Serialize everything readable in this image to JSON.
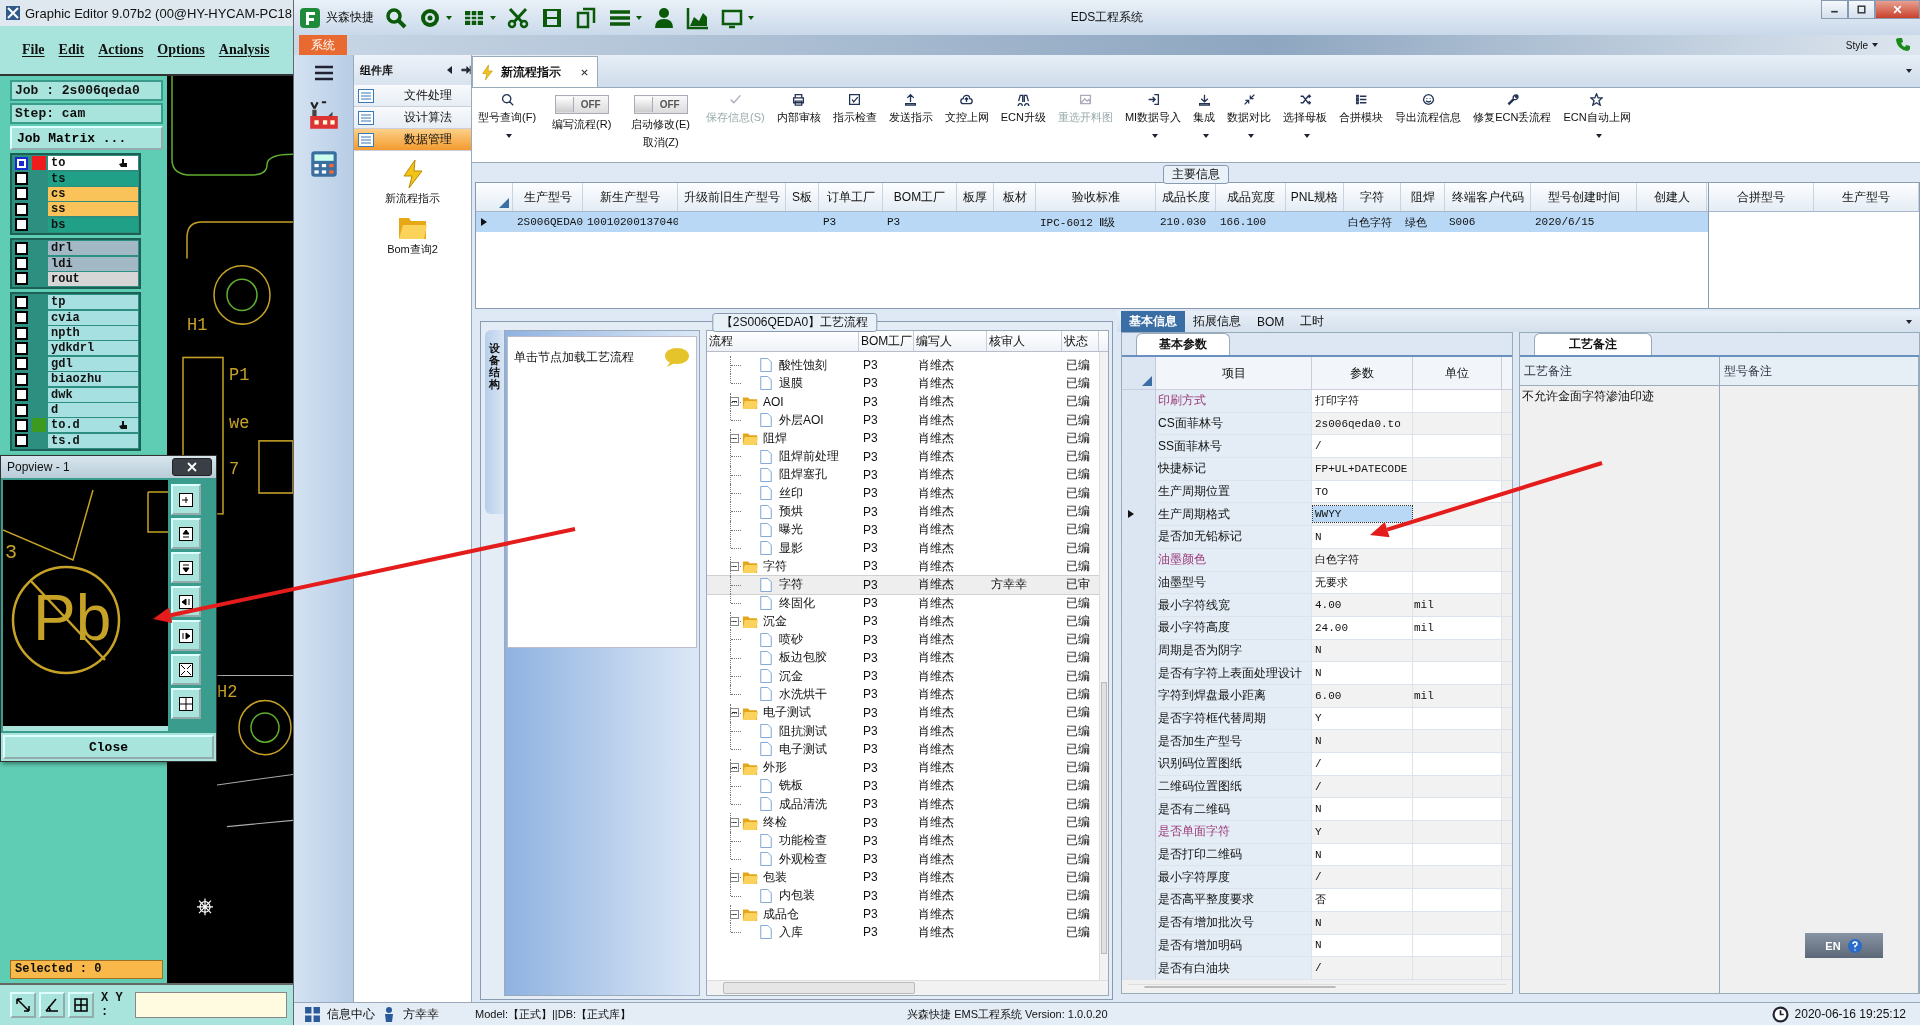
{
  "graphic_editor": {
    "title": "Graphic Editor 9.07b2 (00@HY-HYCAM-PC18",
    "menu": [
      "File",
      "Edit",
      "Actions",
      "Options",
      "Analysis"
    ],
    "job": "Job : 2s006qeda0",
    "step": "Step: cam",
    "matrix_button": "Job Matrix ...",
    "layer_groups": [
      [
        {
          "name": "to",
          "color": "#ffffff",
          "selected": true,
          "work_layer": true,
          "affected": false,
          "marked": true
        },
        {
          "name": "ts",
          "color": "#1fa087",
          "selected": false,
          "work_layer": false,
          "affected": false,
          "marked": false
        },
        {
          "name": "cs",
          "color": "#f9c35a",
          "selected": false,
          "work_layer": false,
          "affected": false,
          "marked": false
        },
        {
          "name": "ss",
          "color": "#f9c35a",
          "selected": false,
          "work_layer": false,
          "affected": false,
          "marked": false
        },
        {
          "name": "bs",
          "color": "#1fa087",
          "selected": false,
          "work_layer": false,
          "affected": false,
          "marked": false
        }
      ],
      [
        {
          "name": "drl",
          "color": "#a2b8c4",
          "selected": false,
          "work_layer": false,
          "affected": false,
          "marked": false
        },
        {
          "name": "ldi",
          "color": "#a2b8c4",
          "selected": false,
          "work_layer": false,
          "affected": false,
          "marked": false
        },
        {
          "name": "rout",
          "color": "#d6d6d6",
          "selected": false,
          "work_layer": false,
          "affected": false,
          "marked": false
        }
      ],
      [
        {
          "name": "tp",
          "color": "#a6e0e0",
          "selected": false,
          "work_layer": false,
          "affected": false,
          "marked": false
        },
        {
          "name": "cvia",
          "color": "#a6e0e0",
          "selected": false,
          "work_layer": false,
          "affected": false,
          "marked": false
        },
        {
          "name": "npth",
          "color": "#a6e0e0",
          "selected": false,
          "work_layer": false,
          "affected": false,
          "marked": false
        },
        {
          "name": "ydkdrl",
          "color": "#a6e0e0",
          "selected": false,
          "work_layer": false,
          "affected": false,
          "marked": false
        },
        {
          "name": "gdl",
          "color": "#a6e0e0",
          "selected": false,
          "work_layer": false,
          "affected": false,
          "marked": false
        },
        {
          "name": "biaozhu",
          "color": "#a6e0e0",
          "selected": false,
          "work_layer": false,
          "affected": false,
          "marked": false
        },
        {
          "name": "dwk",
          "color": "#a6e0e0",
          "selected": false,
          "work_layer": false,
          "affected": false,
          "marked": false
        },
        {
          "name": "d",
          "color": "#a6e0e0",
          "selected": false,
          "work_layer": false,
          "affected": false,
          "marked": false
        },
        {
          "name": "to.d",
          "color": "#a6e0e0",
          "selected": false,
          "work_layer": false,
          "affected": true,
          "marked": true
        },
        {
          "name": "ts.d",
          "color": "#a6e0e0",
          "selected": false,
          "work_layer": false,
          "affected": false,
          "marked": false
        }
      ]
    ],
    "canvas_labels": [
      "H1",
      "P1",
      "we",
      "7",
      "H2"
    ],
    "selected_count": "Selected : 0",
    "xy_label": "X Y :"
  },
  "popview": {
    "title": "Popview - 1",
    "close_button": "Close",
    "symbol_text": "Pb",
    "label": "3"
  },
  "window": {
    "app_name": "兴森快捷",
    "title": "EDS工程系统",
    "system_tab": "系统",
    "style_menu": "Style"
  },
  "component_panel": {
    "title": "组件库",
    "items": [
      {
        "label": "文件处理",
        "selected": false
      },
      {
        "label": "设计算法",
        "selected": false
      },
      {
        "label": "数据管理",
        "selected": true
      }
    ],
    "shortcuts": [
      "新流程指示",
      "Bom查询2"
    ]
  },
  "tab": {
    "label": "新流程指示"
  },
  "toolbar": [
    {
      "kind": "button",
      "label": "型号查询(F)",
      "dropdown": true,
      "disabled": false
    },
    {
      "kind": "toggle",
      "label": "编写流程(R)",
      "switch_text": "OFF",
      "on": false
    },
    {
      "kind": "toggle",
      "label": "启动修改(E)",
      "sublabel": "取消(Z)",
      "switch_text": "OFF",
      "on": false
    },
    {
      "kind": "button",
      "label": "保存信息(S)",
      "dropdown": false,
      "disabled": true
    },
    {
      "kind": "button",
      "label": "内部审核",
      "dropdown": false,
      "disabled": false
    },
    {
      "kind": "button",
      "label": "指示检查",
      "dropdown": false,
      "disabled": false
    },
    {
      "kind": "button",
      "label": "发送指示",
      "dropdown": false,
      "disabled": false
    },
    {
      "kind": "button",
      "label": "文控上网",
      "dropdown": false,
      "disabled": false
    },
    {
      "kind": "button",
      "label": "ECN升级",
      "dropdown": false,
      "disabled": false
    },
    {
      "kind": "button",
      "label": "重选开料图",
      "dropdown": false,
      "disabled": true
    },
    {
      "kind": "button",
      "label": "MI数据导入",
      "dropdown": true,
      "disabled": false
    },
    {
      "kind": "button",
      "label": "集成",
      "dropdown": true,
      "disabled": false
    },
    {
      "kind": "button",
      "label": "数据对比",
      "dropdown": true,
      "disabled": false
    },
    {
      "kind": "button",
      "label": "选择母板",
      "dropdown": true,
      "disabled": false
    },
    {
      "kind": "button",
      "label": "合拼模块",
      "dropdown": false,
      "disabled": false
    },
    {
      "kind": "button",
      "label": "导出流程信息",
      "dropdown": false,
      "disabled": false
    },
    {
      "kind": "button",
      "label": "修复ECN丢流程",
      "dropdown": false,
      "disabled": false
    },
    {
      "kind": "button",
      "label": "ECN自动上网",
      "dropdown": true,
      "disabled": false
    }
  ],
  "main_info": {
    "title": "主要信息",
    "columns": [
      "生产型号",
      "新生产型号",
      "升级前旧生产型号",
      "S板",
      "订单工厂",
      "BOM工厂",
      "板厚",
      "板材",
      "验收标准",
      "成品长度",
      "成品宽度",
      "PNL规格",
      "字符",
      "阻焊",
      "终端客户代码",
      "型号创建时间",
      "创建人"
    ],
    "rows": [
      {
        "selected": true,
        "cells": [
          "2S006QEDA0",
          "10010200137040",
          null,
          null,
          "P3",
          "P3",
          null,
          null,
          "IPC-6012 Ⅱ级",
          "210.030",
          "166.100",
          null,
          "白色字符",
          "绿色",
          "S006",
          "2020/6/15",
          null
        ]
      }
    ],
    "merge_columns": [
      "合拼型号",
      "生产型号"
    ]
  },
  "process": {
    "title": "【2S006QEDA0】工艺流程",
    "side_tab": "设备结构",
    "hint": "单击节点加载工艺流程",
    "columns": [
      "流程",
      "BOM工厂",
      "编写人",
      "核审人",
      "状态"
    ],
    "tree": {
      "continued_children": [
        {
          "label": "酸性蚀刻",
          "bom": "P3",
          "author": "肖维杰",
          "status": "已编",
          "selected": false
        },
        {
          "label": "退膜",
          "bom": "P3",
          "author": "肖维杰",
          "status": "已编",
          "selected": false
        }
      ],
      "groups": [
        {
          "label": "AOI",
          "bom": "P3",
          "author": "肖维杰",
          "status": "已编",
          "selected": false,
          "expanded": true,
          "children": [
            {
              "label": "外层AOI",
              "bom": "P3",
              "author": "肖维杰",
              "status": "已编",
              "selected": false
            }
          ]
        },
        {
          "label": "阻焊",
          "bom": "P3",
          "author": "肖维杰",
          "status": "已编",
          "selected": false,
          "expanded": true,
          "children": [
            {
              "label": "阻焊前处理",
              "bom": "P3",
              "author": "肖维杰",
              "status": "已编",
              "selected": false
            },
            {
              "label": "阻焊塞孔",
              "bom": "P3",
              "author": "肖维杰",
              "status": "已编",
              "selected": false
            },
            {
              "label": "丝印",
              "bom": "P3",
              "author": "肖维杰",
              "status": "已编",
              "selected": false
            },
            {
              "label": "预烘",
              "bom": "P3",
              "author": "肖维杰",
              "status": "已编",
              "selected": false
            },
            {
              "label": "曝光",
              "bom": "P3",
              "author": "肖维杰",
              "status": "已编",
              "selected": false
            },
            {
              "label": "显影",
              "bom": "P3",
              "author": "肖维杰",
              "status": "已编",
              "selected": false
            }
          ]
        },
        {
          "label": "字符",
          "bom": "P3",
          "author": "肖维杰",
          "status": "已编",
          "selected": false,
          "expanded": true,
          "children": [
            {
              "label": "字符",
              "bom": "P3",
              "author": "肖维杰",
              "reviewer": "方幸幸",
              "status": "已审",
              "selected": true
            },
            {
              "label": "终固化",
              "bom": "P3",
              "author": "肖维杰",
              "status": "已编",
              "selected": false
            }
          ]
        },
        {
          "label": "沉金",
          "bom": "P3",
          "author": "肖维杰",
          "status": "已编",
          "selected": false,
          "expanded": true,
          "children": [
            {
              "label": "喷砂",
              "bom": "P3",
              "author": "肖维杰",
              "status": "已编",
              "selected": false
            },
            {
              "label": "板边包胶",
              "bom": "P3",
              "author": "肖维杰",
              "status": "已编",
              "selected": false
            },
            {
              "label": "沉金",
              "bom": "P3",
              "author": "肖维杰",
              "status": "已编",
              "selected": false
            },
            {
              "label": "水洗烘干",
              "bom": "P3",
              "author": "肖维杰",
              "status": "已编",
              "selected": false
            }
          ]
        },
        {
          "label": "电子测试",
          "bom": "P3",
          "author": "肖维杰",
          "status": "已编",
          "selected": false,
          "expanded": true,
          "children": [
            {
              "label": "阻抗测试",
              "bom": "P3",
              "author": "肖维杰",
              "status": "已编",
              "selected": false
            },
            {
              "label": "电子测试",
              "bom": "P3",
              "author": "肖维杰",
              "status": "已编",
              "selected": false
            }
          ]
        },
        {
          "label": "外形",
          "bom": "P3",
          "author": "肖维杰",
          "status": "已编",
          "selected": false,
          "expanded": true,
          "children": [
            {
              "label": "铣板",
              "bom": "P3",
              "author": "肖维杰",
              "status": "已编",
              "selected": false
            },
            {
              "label": "成品清洗",
              "bom": "P3",
              "author": "肖维杰",
              "status": "已编",
              "selected": false
            }
          ]
        },
        {
          "label": "终检",
          "bom": "P3",
          "author": "肖维杰",
          "status": "已编",
          "selected": false,
          "expanded": true,
          "children": [
            {
              "label": "功能检查",
              "bom": "P3",
              "author": "肖维杰",
              "status": "已编",
              "selected": false
            },
            {
              "label": "外观检查",
              "bom": "P3",
              "author": "肖维杰",
              "status": "已编",
              "selected": false
            }
          ]
        },
        {
          "label": "包装",
          "bom": "P3",
          "author": "肖维杰",
          "status": "已编",
          "selected": false,
          "expanded": true,
          "children": [
            {
              "label": "内包装",
              "bom": "P3",
              "author": "肖维杰",
              "status": "已编",
              "selected": false
            }
          ]
        },
        {
          "label": "成品仓",
          "bom": "P3",
          "author": "肖维杰",
          "status": "已编",
          "selected": false,
          "expanded": true,
          "children": [
            {
              "label": "入库",
              "bom": "P3",
              "author": "肖维杰",
              "status": "已编",
              "selected": false
            }
          ]
        }
      ]
    }
  },
  "details": {
    "tabs": [
      {
        "label": "基本信息",
        "selected": true
      },
      {
        "label": "拓展信息",
        "selected": false
      },
      {
        "label": "BOM",
        "selected": false
      },
      {
        "label": "工时",
        "selected": false
      }
    ],
    "params_tab": "基本参数",
    "columns": [
      "项目",
      "参数",
      "单位"
    ],
    "params": [
      {
        "name": "印刷方式",
        "value": "打印字符",
        "emphasized": true,
        "selected": false
      },
      {
        "name": "CS面菲林号",
        "value": "2s006qeda0.to",
        "emphasized": false,
        "selected": false
      },
      {
        "name": "SS面菲林号",
        "value": "/",
        "emphasized": false,
        "selected": false
      },
      {
        "name": "快捷标记",
        "value": "FP+UL+DATECODE",
        "emphasized": false,
        "selected": false
      },
      {
        "name": "生产周期位置",
        "value": "TO",
        "emphasized": false,
        "selected": false
      },
      {
        "name": "生产周期格式",
        "value": "WWYY",
        "emphasized": false,
        "selected": true
      },
      {
        "name": "是否加无铅标记",
        "value": "N",
        "emphasized": false,
        "selected": false
      },
      {
        "name": "油墨颜色",
        "value": "白色字符",
        "emphasized": true,
        "selected": false
      },
      {
        "name": "油墨型号",
        "value": "无要求",
        "emphasized": false,
        "selected": false
      },
      {
        "name": "最小字符线宽",
        "value": "4.00",
        "unit": "mil",
        "emphasized": false,
        "selected": false
      },
      {
        "name": "最小字符高度",
        "value": "24.00",
        "unit": "mil",
        "emphasized": false,
        "selected": false
      },
      {
        "name": "周期是否为阴字",
        "value": "N",
        "emphasized": false,
        "selected": false
      },
      {
        "name": "是否有字符上表面处理设计",
        "value": "N",
        "emphasized": false,
        "selected": false
      },
      {
        "name": "字符到焊盘最小距离",
        "value": "6.00",
        "unit": "mil",
        "emphasized": false,
        "selected": false
      },
      {
        "name": "是否字符框代替周期",
        "value": "Y",
        "emphasized": false,
        "selected": false
      },
      {
        "name": "是否加生产型号",
        "value": "N",
        "emphasized": false,
        "selected": false
      },
      {
        "name": "识别码位置图纸",
        "value": "/",
        "emphasized": false,
        "selected": false
      },
      {
        "name": "二维码位置图纸",
        "value": "/",
        "emphasized": false,
        "selected": false
      },
      {
        "name": "是否有二维码",
        "value": "N",
        "emphasized": false,
        "selected": false
      },
      {
        "name": "是否单面字符",
        "value": "Y",
        "emphasized": true,
        "selected": false
      },
      {
        "name": "是否打印二维码",
        "value": "N",
        "emphasized": false,
        "selected": false
      },
      {
        "name": "最小字符厚度",
        "value": "/",
        "emphasized": false,
        "selected": false
      },
      {
        "name": "是否高平整度要求",
        "value": "否",
        "emphasized": false,
        "selected": false
      },
      {
        "name": "是否有增加批次号",
        "value": "N",
        "emphasized": false,
        "selected": false
      },
      {
        "name": "是否有增加明码",
        "value": "N",
        "emphasized": false,
        "selected": false
      },
      {
        "name": "是否有白油块",
        "value": "/",
        "emphasized": false,
        "selected": false
      }
    ],
    "notes_tab": "工艺备注",
    "notes_columns": [
      "工艺备注",
      "型号备注"
    ],
    "process_note": "不允许金面字符渗油印迹",
    "language": "EN"
  },
  "status_bar": {
    "info_center": "信息中心",
    "user": "方幸幸",
    "model": "Model:【正式】||DB:【正式库】",
    "version": "兴森快捷 EMS工程系统 Version: 1.0.0.20",
    "datetime": "2020-06-16 19:25:12"
  }
}
